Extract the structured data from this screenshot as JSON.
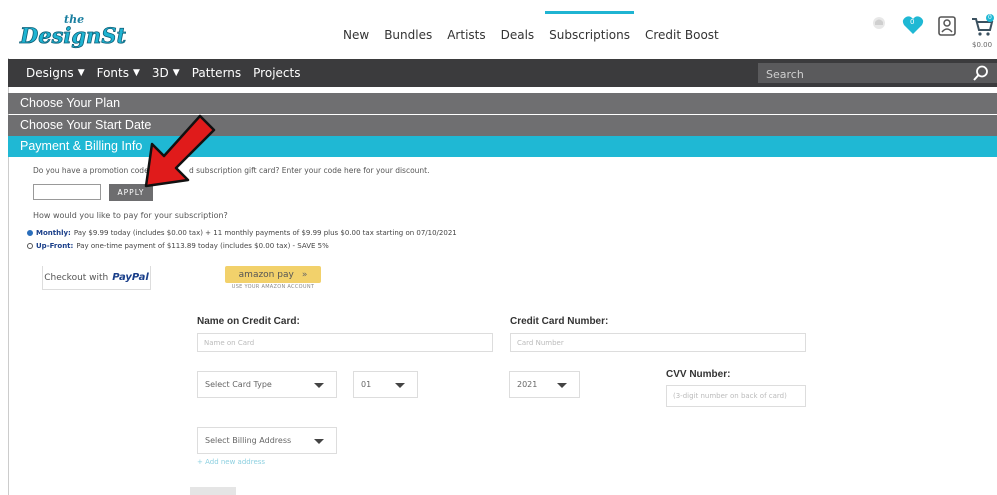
{
  "header": {
    "logo_text": "theDesignStore",
    "nav": [
      "New",
      "Bundles",
      "Artists",
      "Deals",
      "Subscriptions",
      "Credit Boost"
    ],
    "active_nav": "Subscriptions",
    "wishlist_count": "0",
    "cart_count": "0",
    "cart_amount": "$0.00"
  },
  "main_nav": {
    "items": [
      {
        "label": "Designs",
        "dropdown": true
      },
      {
        "label": "Fonts",
        "dropdown": true
      },
      {
        "label": "3D",
        "dropdown": true
      },
      {
        "label": "Patterns",
        "dropdown": false
      },
      {
        "label": "Projects",
        "dropdown": false
      }
    ],
    "search_placeholder": "Search"
  },
  "steps": {
    "plan": "Choose Your Plan",
    "start_date": "Choose Your Start Date",
    "payment": "Payment & Billing Info"
  },
  "promo": {
    "prompt_start": "Do you have a promotion code",
    "prompt_end": "d subscription gift card? Enter your code here for your discount.",
    "apply_label": "APPLY"
  },
  "payment_choice": {
    "question": "How would you like to pay for your subscription?",
    "monthly_label": "Monthly:",
    "monthly_text": "Pay $9.99 today (includes $0.00 tax) + 11 monthly payments of $9.99 plus $0.00 tax starting on 07/10/2021",
    "upfront_label": "Up-Front:",
    "upfront_text": "Pay one-time payment of $113.89 today (includes $0.00 tax) - SAVE 5%"
  },
  "wallets": {
    "paypal_prefix": "Checkout with",
    "paypal_brand": "PayPal",
    "amazon_label": "amazon pay",
    "amazon_sub": "USE YOUR AMAZON ACCOUNT"
  },
  "card_form": {
    "name_label": "Name on Credit Card:",
    "name_placeholder": "Name on Card",
    "number_label": "Credit Card Number:",
    "number_placeholder": "Card Number",
    "card_type": "Select Card Type",
    "exp_month": "01",
    "exp_year": "2021",
    "cvv_label": "CVV Number:",
    "cvv_placeholder": "(3-digit number on back of card)",
    "billing_address": "Select Billing Address",
    "add_address": "+ Add new address"
  },
  "colors": {
    "accent": "#1fb8d4",
    "dark_nav": "#3b3b3d",
    "step_grey": "#6f6f71",
    "arrow_red": "#e01b1b"
  }
}
